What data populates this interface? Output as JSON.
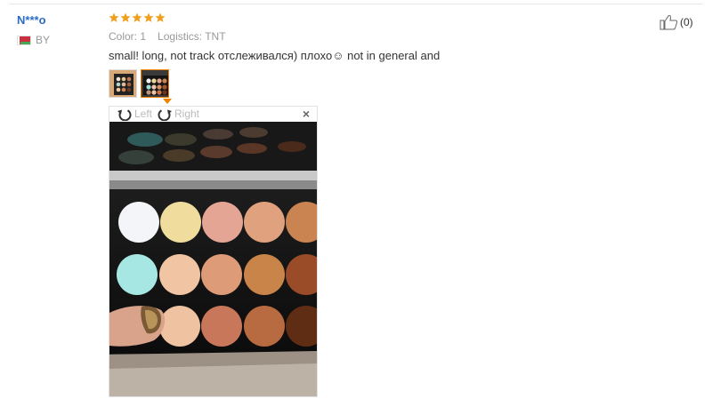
{
  "reviewer": {
    "name": "N***o",
    "country": "BY"
  },
  "rating": {
    "stars": 5,
    "max": 5,
    "color": "#f0a020"
  },
  "attributes": [
    {
      "key": "Color:",
      "value": "1"
    },
    {
      "key": "Logistics:",
      "value": "TNT"
    }
  ],
  "review_text": "small! long, not track отслеживался) плохо☺ not in general and",
  "images": {
    "thumbnails": [
      "photo-thumbnail-1",
      "photo-thumbnail-2"
    ],
    "selected_index": 1
  },
  "viewer": {
    "rotate_left_label": "Left",
    "rotate_right_label": "Right",
    "close_label": "×"
  },
  "helpful": {
    "count": "(0)"
  },
  "colors": {
    "accent": "#f08200",
    "username": "#2c6cc4"
  }
}
